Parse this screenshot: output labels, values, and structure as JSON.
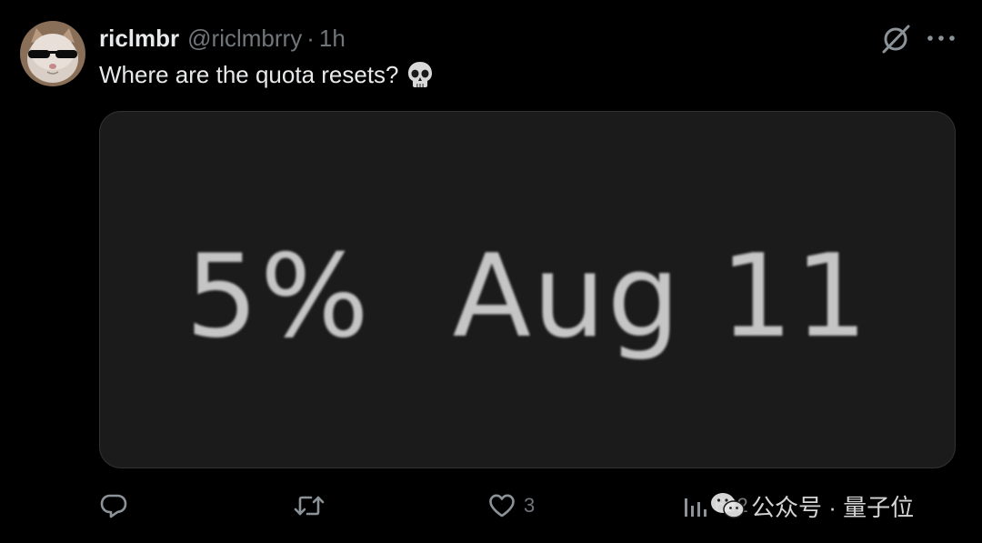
{
  "post": {
    "display_name": "riclmbr",
    "handle": "@riclmbrry",
    "separator": "·",
    "time": "1h",
    "text": "Where are the quota resets?",
    "emoji_icon": "skull-icon"
  },
  "media": {
    "percent": "5%",
    "date": "Aug 11"
  },
  "actions": {
    "reply_count": "",
    "retweet_count": "",
    "like_count": "3",
    "views_count": "692"
  },
  "watermark": {
    "text": "公众号 · 量子位"
  },
  "icons": {
    "avatar": "cat-with-sunglasses-avatar",
    "grok": "grok-icon",
    "more": "more-icon",
    "reply": "reply-icon",
    "retweet": "retweet-icon",
    "like": "heart-icon",
    "views": "views-icon"
  },
  "colors": {
    "background": "#000000",
    "primary_text": "#e7e9ea",
    "secondary_text": "#71767b",
    "media_background": "#1b1b1c",
    "media_text": "#c5c5c5"
  }
}
